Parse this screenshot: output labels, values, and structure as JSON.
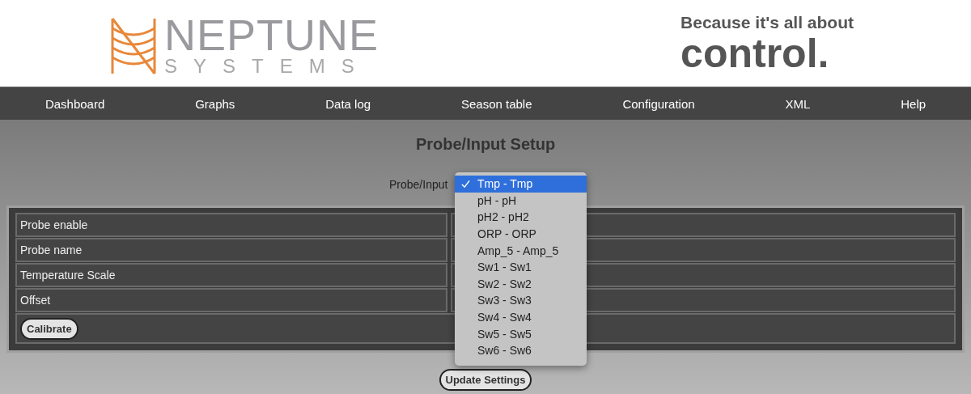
{
  "header": {
    "logo_top": "NEPTUNE",
    "logo_bottom": "SYSTEMS",
    "slogan_top": "Because it's all about",
    "slogan_bottom": "control."
  },
  "nav": [
    "Dashboard",
    "Graphs",
    "Data log",
    "Season table",
    "Configuration",
    "XML",
    "Help"
  ],
  "title": "Probe/Input Setup",
  "probe_select": {
    "label": "Probe/Input",
    "options": [
      {
        "label": "Tmp - Tmp",
        "selected": true
      },
      {
        "label": "pH - pH",
        "selected": false
      },
      {
        "label": "pH2 - pH2",
        "selected": false
      },
      {
        "label": "ORP - ORP",
        "selected": false
      },
      {
        "label": "Amp_5 - Amp_5",
        "selected": false
      },
      {
        "label": "Sw1 - Sw1",
        "selected": false
      },
      {
        "label": "Sw2 - Sw2",
        "selected": false
      },
      {
        "label": "Sw3 - Sw3",
        "selected": false
      },
      {
        "label": "Sw4 - Sw4",
        "selected": false
      },
      {
        "label": "Sw5 - Sw5",
        "selected": false
      },
      {
        "label": "Sw6 - Sw6",
        "selected": false
      }
    ]
  },
  "settings": [
    {
      "label": "Probe enable"
    },
    {
      "label": "Probe name"
    },
    {
      "label": "Temperature Scale"
    },
    {
      "label": "Offset"
    }
  ],
  "calibrate_button": "Calibrate",
  "update_button": "Update Settings"
}
